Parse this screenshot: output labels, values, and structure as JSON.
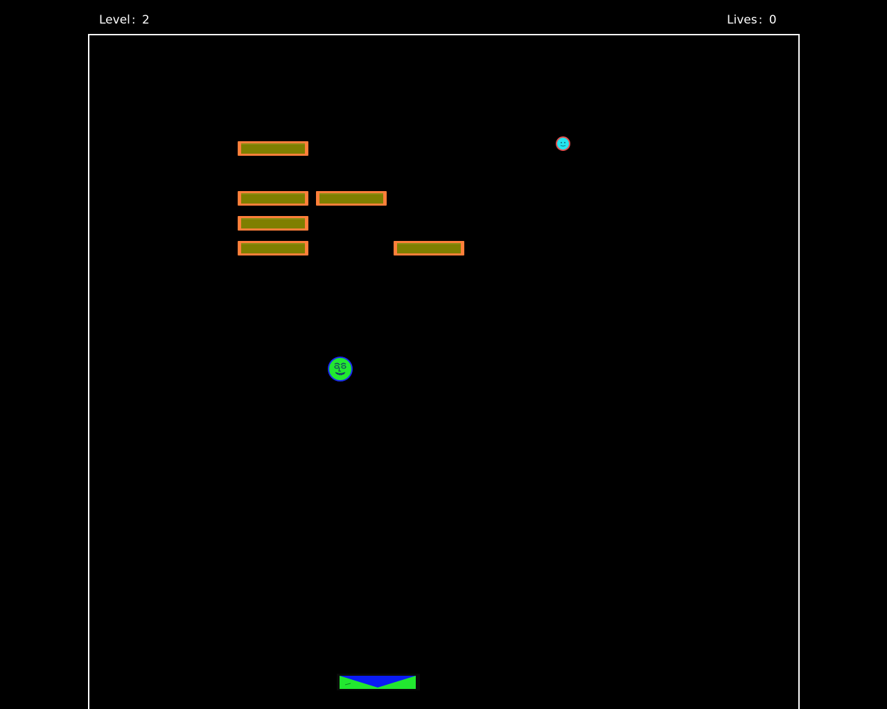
{
  "hud": {
    "level_label": "Level",
    "level_value": "2",
    "lives_label": "Lives",
    "lives_value": "0",
    "separator": ":"
  },
  "colors": {
    "background": "#000000",
    "arena_border": "#ffffff",
    "hud_text": "#ffffff",
    "brick_border": "#ff7f3a",
    "brick_fill": "#7f7f00",
    "ball_small": "#24e4ee",
    "ball_large": "#22e830",
    "paddle_blue": "#0a1cf5",
    "paddle_green": "#22e830"
  },
  "bricks": {
    "remaining": 6
  },
  "balls": [
    {
      "name": "ball-cyan",
      "icon": "face-ball-icon"
    },
    {
      "name": "ball-green",
      "icon": "face-ball-icon"
    }
  ],
  "paddle": {
    "icon": "bowtie-paddle-icon"
  }
}
